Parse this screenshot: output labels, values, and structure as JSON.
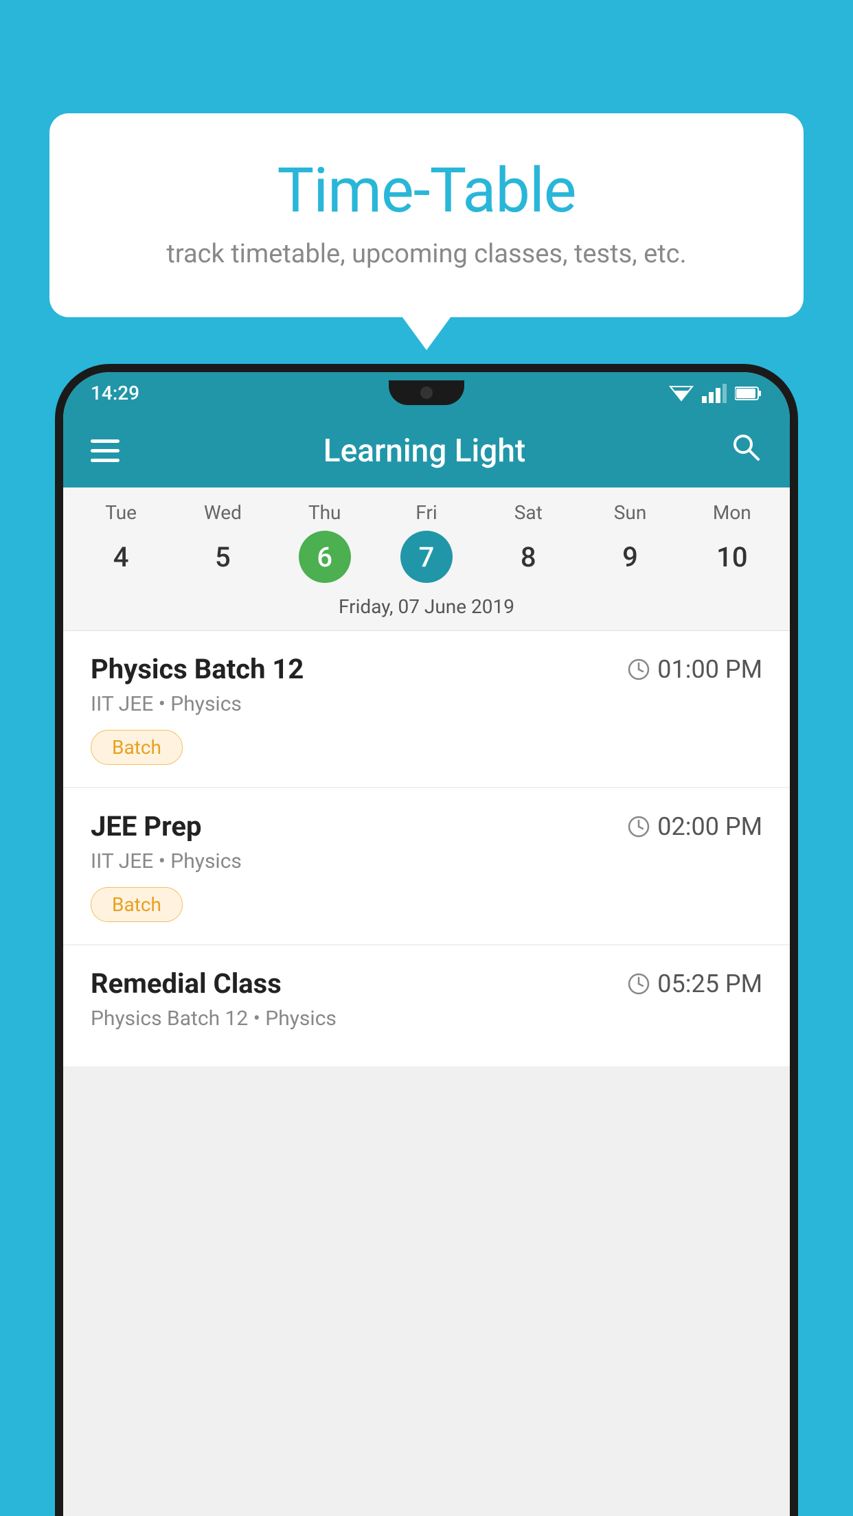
{
  "background_color": "#29b6d8",
  "tooltip": {
    "title": "Time-Table",
    "subtitle": "track timetable, upcoming classes, tests, etc."
  },
  "phone": {
    "status_bar": {
      "time": "14:29",
      "icons": [
        "wifi",
        "signal",
        "battery"
      ]
    },
    "app_bar": {
      "title": "Learning Light",
      "menu_label": "menu",
      "search_label": "search"
    },
    "calendar": {
      "days": [
        {
          "name": "Tue",
          "num": "4",
          "state": "normal"
        },
        {
          "name": "Wed",
          "num": "5",
          "state": "normal"
        },
        {
          "name": "Thu",
          "num": "6",
          "state": "today"
        },
        {
          "name": "Fri",
          "num": "7",
          "state": "selected"
        },
        {
          "name": "Sat",
          "num": "8",
          "state": "normal"
        },
        {
          "name": "Sun",
          "num": "9",
          "state": "normal"
        },
        {
          "name": "Mon",
          "num": "10",
          "state": "normal"
        }
      ],
      "selected_date_label": "Friday, 07 June 2019"
    },
    "schedule_items": [
      {
        "title": "Physics Batch 12",
        "time": "01:00 PM",
        "subtitle": "IIT JEE • Physics",
        "tag": "Batch"
      },
      {
        "title": "JEE Prep",
        "time": "02:00 PM",
        "subtitle": "IIT JEE • Physics",
        "tag": "Batch"
      },
      {
        "title": "Remedial Class",
        "time": "05:25 PM",
        "subtitle": "Physics Batch 12 • Physics",
        "tag": null
      }
    ]
  }
}
